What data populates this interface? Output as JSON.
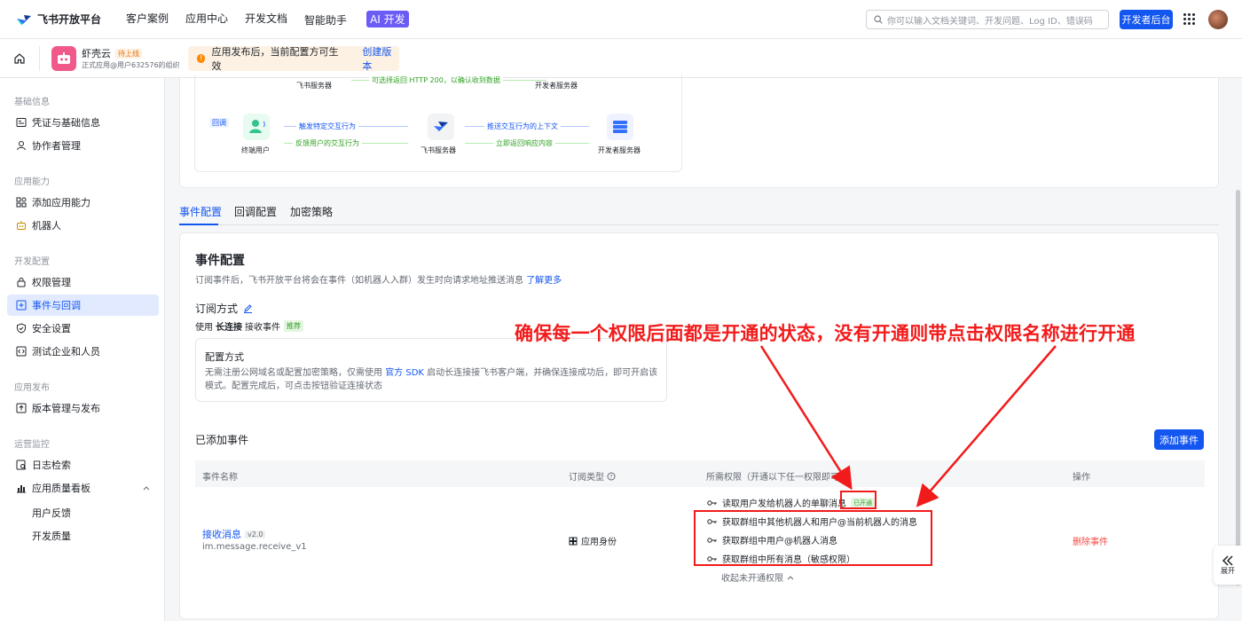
{
  "topbar": {
    "logo_text": "飞书开放平台",
    "nav": [
      "客户案例",
      "应用中心",
      "开发文档",
      "智能助手"
    ],
    "ai_badge": "AI 开发",
    "search_placeholder": "你可以输入文档关键词、开发问题、Log ID、错误码",
    "dev_console": "开发者后台"
  },
  "app": {
    "name": "虾壳云",
    "status": "待上线",
    "org": "正式应用@用户632576的组织"
  },
  "notice": {
    "text": "应用发布后，当前配置方可生效",
    "action": "创建版本"
  },
  "sidebar": {
    "groups": [
      "基础信息",
      "应用能力",
      "开发配置",
      "应用发布",
      "运营监控"
    ],
    "items": [
      "凭证与基础信息",
      "协作者管理",
      "添加应用能力",
      "机器人",
      "权限管理",
      "事件与回调",
      "安全设置",
      "测试企业和人员",
      "版本管理与发布",
      "日志检索",
      "应用质量看板"
    ],
    "sub_items": [
      "用户反馈",
      "开发质量"
    ]
  },
  "diagram": {
    "feishu_server": "飞书服务器",
    "dev_server": "开发者服务器",
    "top_flow": "可选择返回 HTTP 200，以确认收到数据",
    "callback_tag": "回调",
    "end_user": "终端用户",
    "flow1": "触发特定交互行为",
    "flow2": "反馈用户的交互行为",
    "flow3": "推送交互行为的上下文",
    "flow4": "立即返回响应内容"
  },
  "tabs": [
    "事件配置",
    "回调配置",
    "加密策略"
  ],
  "event": {
    "title": "事件配置",
    "desc": "订阅事件后，飞书开放平台将会在事件（如机器人入群）发生时向请求地址推送消息",
    "learn_more": "了解更多",
    "sub_title": "订阅方式",
    "mode_prefix": "使用",
    "mode_name": "长连接",
    "mode_suffix": "接收事件",
    "mode_tag": "推荐",
    "cfg_title": "配置方式",
    "cfg_text1": "无需注册公网域名或配置加密策略，仅需使用",
    "cfg_link": "官方 SDK",
    "cfg_text2": "启动长连接接飞书客户端，并确保连接成功后，即可开启该模式。配置完成后，可点击按钮验证连接状态",
    "added_title": "已添加事件",
    "add_button": "添加事件"
  },
  "table": {
    "headers": [
      "事件名称",
      "订阅类型",
      "所需权限（开通以下任一权限即可）",
      "操作"
    ],
    "row": {
      "name": "接收消息",
      "version": "v2.0",
      "code": "im.message.receive_v1",
      "type": "应用身份",
      "permissions": [
        "读取用户发给机器人的单聊消息",
        "获取群组中其他机器人和用户@当前机器人的消息",
        "获取群组中用户@机器人消息",
        "获取群组中所有消息（敏感权限）"
      ],
      "opened_tag": "已开通",
      "collapse": "收起未开通权限",
      "delete": "删除事件"
    }
  },
  "annotation": "确保每一个权限后面都是开通的状态，没有开通则带点击权限名称进行开通",
  "expand_label": "展开",
  "colors": {
    "accent": "#1456f0",
    "annotation": "#f21b1b",
    "success": "#2ea121",
    "danger": "#f54a45"
  }
}
